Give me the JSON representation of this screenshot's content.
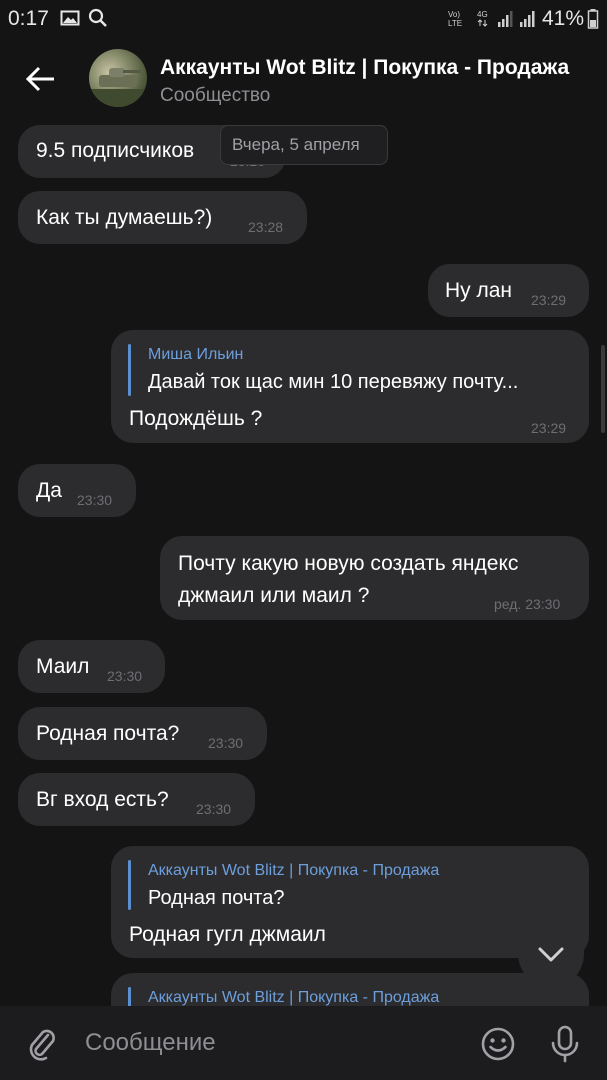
{
  "status_bar": {
    "time": "0:17",
    "network_label": "Vo) LTE",
    "network_type": "4G",
    "battery": "41%"
  },
  "header": {
    "title": "Аккаунты Wot Blitz | Покупка - Продажа",
    "subtitle": "Сообщество"
  },
  "date_chip": "Вчера, 5 апреля",
  "messages": [
    {
      "text": "9.5 подписчиков",
      "time": "23:28",
      "direction": "incoming"
    },
    {
      "text": "Как ты думаешь?)",
      "time": "23:28",
      "direction": "incoming"
    },
    {
      "text": "Ну лан",
      "time": "23:29",
      "direction": "outgoing"
    },
    {
      "reply_name": "Миша Ильин",
      "reply_text": "Давай ток щас мин 10 перевяжу почту...",
      "text": "Подождёшь ?",
      "time": "23:29",
      "direction": "outgoing"
    },
    {
      "text": "Да",
      "time": "23:30",
      "direction": "incoming"
    },
    {
      "line1": "Почту какую новую создать яндекс",
      "line2": "джмаил или маил ?",
      "time": "ред. 23:30",
      "direction": "outgoing"
    },
    {
      "text": "Маил",
      "time": "23:30",
      "direction": "incoming"
    },
    {
      "text": "Родная почта?",
      "time": "23:30",
      "direction": "incoming"
    },
    {
      "text": "Вг вход есть?",
      "time": "23:30",
      "direction": "incoming"
    },
    {
      "reply_name": "Аккаунты Wot Blitz | Покупка - Продажа",
      "reply_text": "Родная почта?",
      "text": "Родная гугл джмаил",
      "direction": "outgoing"
    },
    {
      "reply_name": "Аккаунты Wot Blitz | Покупка - Продажа",
      "direction": "outgoing"
    }
  ],
  "input": {
    "placeholder": "Сообщение"
  },
  "icons": {
    "back": "arrow-left-icon",
    "attach": "paperclip-icon",
    "emoji": "smile-icon",
    "mic": "microphone-icon",
    "scroll_down": "chevron-down-icon"
  },
  "colors": {
    "background": "#141414",
    "bubble": "#2c2c2e",
    "reply_accent": "#5a8fd0",
    "timestamp": "#6e6e73"
  }
}
